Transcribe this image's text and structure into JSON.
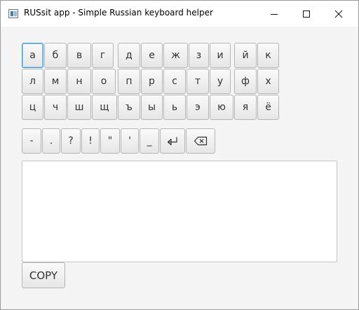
{
  "window": {
    "title": "RUSsit app - Simple Russian keyboard helper"
  },
  "keyboard": {
    "row1": [
      "а",
      "б",
      "в",
      "г",
      "д",
      "е",
      "ж",
      "з",
      "и",
      "й",
      "к"
    ],
    "row2": [
      "л",
      "м",
      "н",
      "о",
      "п",
      "р",
      "с",
      "т",
      "у",
      "ф",
      "х"
    ],
    "row3": [
      "ц",
      "ч",
      "ш",
      "щ",
      "ъ",
      "ы",
      "ь",
      "э",
      "ю",
      "я",
      "ё"
    ],
    "punctuation": [
      "-",
      ".",
      "?",
      "!",
      "\"",
      "'",
      "_"
    ],
    "icons": {
      "enter": "return-key-icon",
      "backspace": "backspace-icon"
    }
  },
  "editor": {
    "value": ""
  },
  "copy_label": "COPY"
}
